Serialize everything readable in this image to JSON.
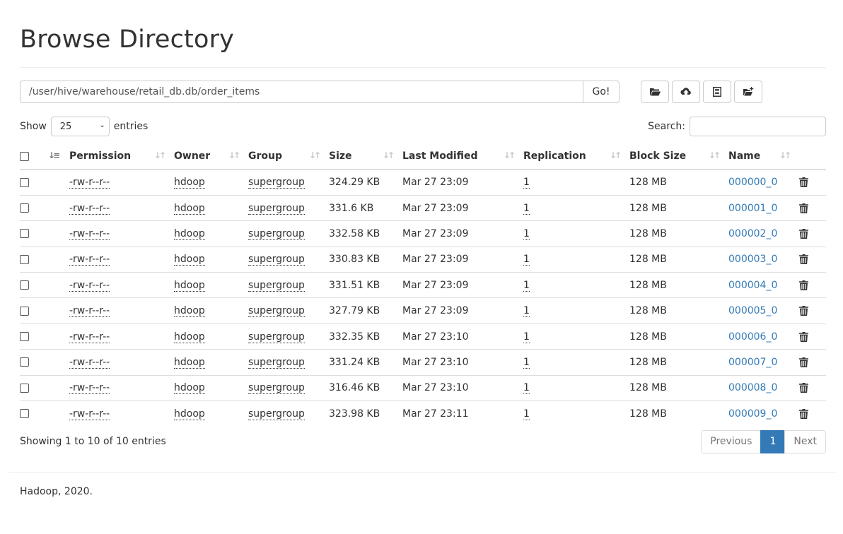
{
  "header": {
    "title": "Browse Directory"
  },
  "path": {
    "value": "/user/hive/warehouse/retail_db.db/order_items",
    "go_label": "Go!"
  },
  "toolbar": [
    "open-folder-icon",
    "upload-icon",
    "cut-paste-icon",
    "create-folder-icon"
  ],
  "length": {
    "show_label": "Show",
    "selected": "25",
    "entries_label": "entries"
  },
  "search": {
    "label": "Search:",
    "value": ""
  },
  "columns": [
    "Permission",
    "Owner",
    "Group",
    "Size",
    "Last Modified",
    "Replication",
    "Block Size",
    "Name"
  ],
  "rows": [
    {
      "permission": "-rw-r--r--",
      "owner": "hdoop",
      "group": "supergroup",
      "size": "324.29 KB",
      "modified": "Mar 27 23:09",
      "replication": "1",
      "block_size": "128 MB",
      "name": "000000_0"
    },
    {
      "permission": "-rw-r--r--",
      "owner": "hdoop",
      "group": "supergroup",
      "size": "331.6 KB",
      "modified": "Mar 27 23:09",
      "replication": "1",
      "block_size": "128 MB",
      "name": "000001_0"
    },
    {
      "permission": "-rw-r--r--",
      "owner": "hdoop",
      "group": "supergroup",
      "size": "332.58 KB",
      "modified": "Mar 27 23:09",
      "replication": "1",
      "block_size": "128 MB",
      "name": "000002_0"
    },
    {
      "permission": "-rw-r--r--",
      "owner": "hdoop",
      "group": "supergroup",
      "size": "330.83 KB",
      "modified": "Mar 27 23:09",
      "replication": "1",
      "block_size": "128 MB",
      "name": "000003_0"
    },
    {
      "permission": "-rw-r--r--",
      "owner": "hdoop",
      "group": "supergroup",
      "size": "331.51 KB",
      "modified": "Mar 27 23:09",
      "replication": "1",
      "block_size": "128 MB",
      "name": "000004_0"
    },
    {
      "permission": "-rw-r--r--",
      "owner": "hdoop",
      "group": "supergroup",
      "size": "327.79 KB",
      "modified": "Mar 27 23:09",
      "replication": "1",
      "block_size": "128 MB",
      "name": "000005_0"
    },
    {
      "permission": "-rw-r--r--",
      "owner": "hdoop",
      "group": "supergroup",
      "size": "332.35 KB",
      "modified": "Mar 27 23:10",
      "replication": "1",
      "block_size": "128 MB",
      "name": "000006_0"
    },
    {
      "permission": "-rw-r--r--",
      "owner": "hdoop",
      "group": "supergroup",
      "size": "331.24 KB",
      "modified": "Mar 27 23:10",
      "replication": "1",
      "block_size": "128 MB",
      "name": "000007_0"
    },
    {
      "permission": "-rw-r--r--",
      "owner": "hdoop",
      "group": "supergroup",
      "size": "316.46 KB",
      "modified": "Mar 27 23:10",
      "replication": "1",
      "block_size": "128 MB",
      "name": "000008_0"
    },
    {
      "permission": "-rw-r--r--",
      "owner": "hdoop",
      "group": "supergroup",
      "size": "323.98 KB",
      "modified": "Mar 27 23:11",
      "replication": "1",
      "block_size": "128 MB",
      "name": "000009_0"
    }
  ],
  "table_info": "Showing 1 to 10 of 10 entries",
  "pagination": {
    "previous": "Previous",
    "current": "1",
    "next": "Next"
  },
  "footer": "Hadoop, 2020.",
  "colors": {
    "link": "#337ab7",
    "active_page": "#337ab7"
  }
}
